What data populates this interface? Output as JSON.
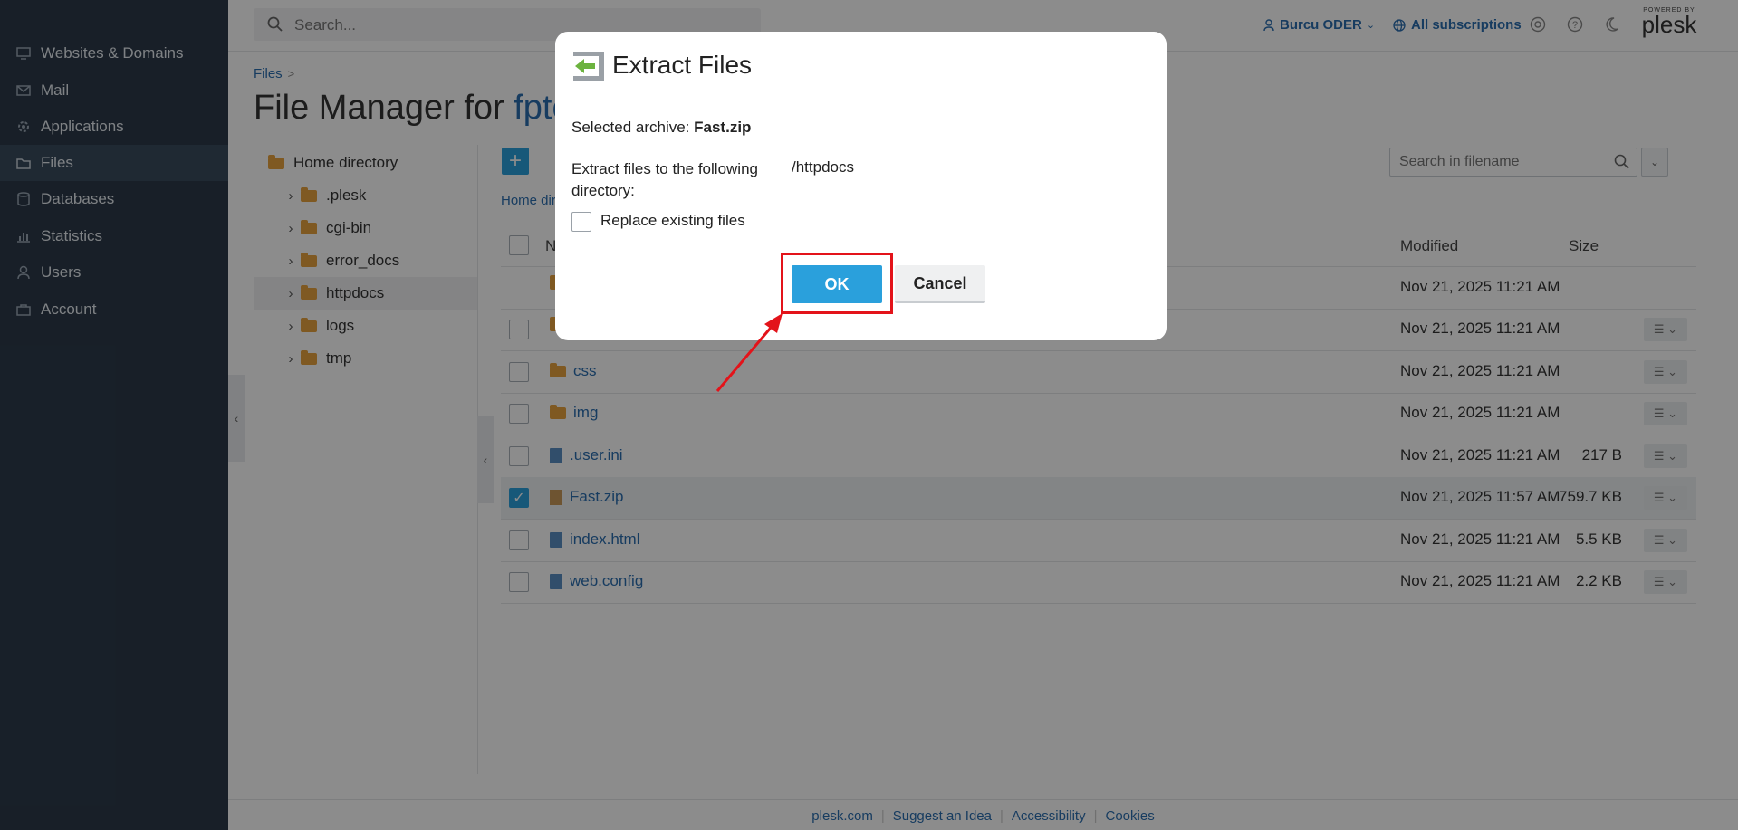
{
  "sidebar": {
    "items": [
      {
        "label": "Websites & Domains",
        "icon": "monitor-icon"
      },
      {
        "label": "Mail",
        "icon": "envelope-icon"
      },
      {
        "label": "Applications",
        "icon": "gear-icon"
      },
      {
        "label": "Files",
        "icon": "folder-icon"
      },
      {
        "label": "Databases",
        "icon": "database-icon"
      },
      {
        "label": "Statistics",
        "icon": "bar-chart-icon"
      },
      {
        "label": "Users",
        "icon": "user-icon"
      },
      {
        "label": "Account",
        "icon": "account-icon"
      }
    ],
    "active": "Files"
  },
  "header": {
    "search_placeholder": "Search...",
    "user": "Burcu ODER",
    "subscriptions": "All subscriptions",
    "logo_powered": "POWERED BY",
    "logo_name": "plesk"
  },
  "breadcrumb": {
    "files": "Files",
    "separator": ">"
  },
  "page": {
    "title_prefix": "File Manager for",
    "title_domain": "fptc"
  },
  "tree": {
    "root": "Home directory",
    "items": [
      ".plesk",
      "cgi-bin",
      "error_docs",
      "httpdocs",
      "logs",
      "tmp"
    ],
    "selected": "httpdocs"
  },
  "toolbar": {
    "add_label": "+",
    "path_breadcrumb": "Home dir",
    "file_search_placeholder": "Search in filename"
  },
  "table": {
    "columns": {
      "name": "N",
      "modified": "Modified",
      "size": "Size"
    },
    "rows": [
      {
        "name": "",
        "modified": "Nov 21, 2025 11:21 AM",
        "size": "",
        "type": "up"
      },
      {
        "name": "",
        "modified": "Nov 21, 2025 11:21 AM",
        "size": "",
        "type": "folder"
      },
      {
        "name": "css",
        "modified": "Nov 21, 2025 11:21 AM",
        "size": "",
        "type": "folder"
      },
      {
        "name": "img",
        "modified": "Nov 21, 2025 11:21 AM",
        "size": "",
        "type": "folder"
      },
      {
        "name": ".user.ini",
        "modified": "Nov 21, 2025 11:21 AM",
        "size": "217 B",
        "type": "file"
      },
      {
        "name": "Fast.zip",
        "modified": "Nov 21, 2025 11:57 AM",
        "size": "759.7 KB",
        "type": "zip",
        "selected": true
      },
      {
        "name": "index.html",
        "modified": "Nov 21, 2025 11:21 AM",
        "size": "5.5 KB",
        "type": "file"
      },
      {
        "name": "web.config",
        "modified": "Nov 21, 2025 11:21 AM",
        "size": "2.2 KB",
        "type": "file"
      }
    ]
  },
  "footer": {
    "links": [
      "plesk.com",
      "Suggest an Idea",
      "Accessibility",
      "Cookies"
    ]
  },
  "modal": {
    "title": "Extract Files",
    "archive_label": "Selected archive:",
    "archive_name": "Fast.zip",
    "directory_label": "Extract files to the following directory:",
    "directory_value": "/httpdocs",
    "replace_label": "Replace existing files",
    "ok_label": "OK",
    "cancel_label": "Cancel"
  },
  "colors": {
    "sidebar": "#2c3a4a",
    "accent": "#2aa0dc",
    "link": "#2b6eb0",
    "annotation": "#e3131a"
  }
}
